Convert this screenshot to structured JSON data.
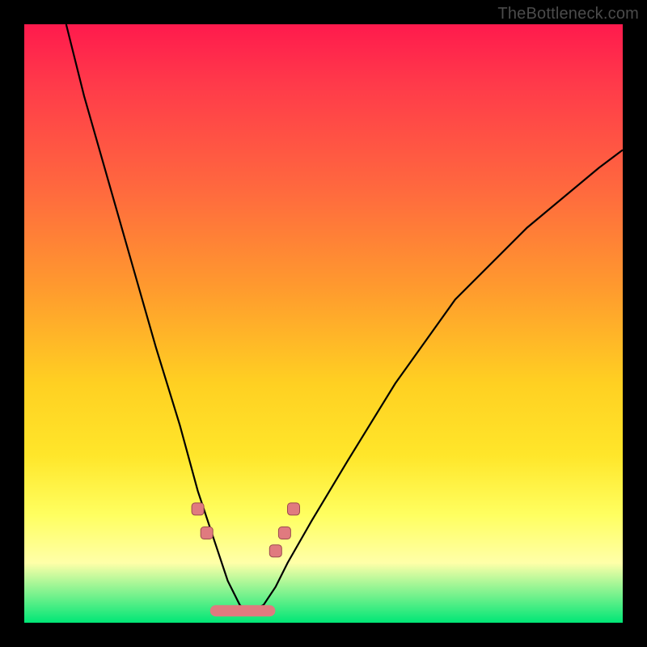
{
  "watermark": "TheBottleneck.com",
  "colors": {
    "gradient_top": "#ff1a4d",
    "gradient_mid1": "#ff9a2e",
    "gradient_mid2": "#ffe62a",
    "gradient_pale": "#ffffa8",
    "gradient_bottom": "#00e676",
    "curve": "#000000",
    "marker_fill": "#e07a7f",
    "marker_stroke": "#9a4a4e",
    "frame": "#000000"
  },
  "chart_data": {
    "type": "line",
    "title": "",
    "xlabel": "",
    "ylabel": "",
    "xlim": [
      0,
      100
    ],
    "ylim": [
      0,
      100
    ],
    "grid": false,
    "legend": false,
    "note": "Axes are unitless; values estimated from pixel positions. y=0 is bottom (green), y=100 is top (red). Single V-shaped curve with minimum near x≈37.",
    "series": [
      {
        "name": "bottleneck-curve",
        "x": [
          7,
          10,
          14,
          18,
          22,
          26,
          29,
          32,
          34,
          36,
          37,
          38,
          40,
          42,
          44,
          48,
          54,
          62,
          72,
          84,
          96,
          100
        ],
        "y": [
          100,
          88,
          74,
          60,
          46,
          33,
          22,
          13,
          7,
          3,
          2,
          2,
          3,
          6,
          10,
          17,
          27,
          40,
          54,
          66,
          76,
          79
        ]
      }
    ],
    "markers": [
      {
        "name": "left-marker-1",
        "x": 29,
        "y": 19
      },
      {
        "name": "left-marker-2",
        "x": 30.5,
        "y": 15
      },
      {
        "name": "right-marker-1",
        "x": 42,
        "y": 12
      },
      {
        "name": "right-marker-2",
        "x": 43.5,
        "y": 15
      },
      {
        "name": "right-marker-3",
        "x": 45,
        "y": 19
      }
    ],
    "trough_band": {
      "x_start": 32,
      "x_end": 41,
      "y": 2
    }
  }
}
